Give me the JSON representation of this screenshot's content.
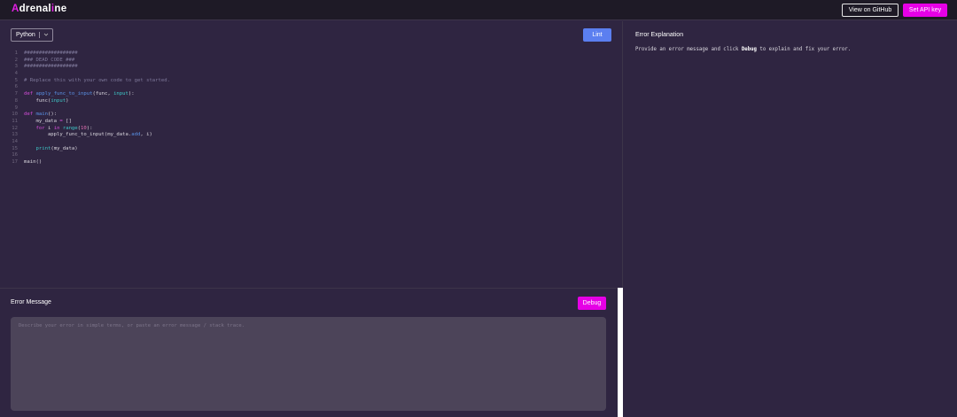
{
  "header": {
    "logo_prefix": "A",
    "logo_rest": "drenal",
    "logo_i": "i",
    "logo_suffix": "ne",
    "github_label": "View on GitHub",
    "api_key_label": "Set API key"
  },
  "editor": {
    "language": "Python",
    "lint_label": "Lint",
    "lines": [
      {
        "n": "1",
        "parts": [
          {
            "t": "##################",
            "c": "comment"
          }
        ]
      },
      {
        "n": "2",
        "parts": [
          {
            "t": "### DEAD CODE ###",
            "c": "comment"
          }
        ]
      },
      {
        "n": "3",
        "parts": [
          {
            "t": "##################",
            "c": "comment"
          }
        ]
      },
      {
        "n": "4",
        "parts": []
      },
      {
        "n": "5",
        "parts": [
          {
            "t": "# Replace this with your own code to get started.",
            "c": "comment"
          }
        ]
      },
      {
        "n": "6",
        "parts": []
      },
      {
        "n": "7",
        "parts": [
          {
            "t": "def",
            "c": "kw"
          },
          {
            "t": " ",
            "c": ""
          },
          {
            "t": "apply_func_to_input",
            "c": "fn"
          },
          {
            "t": "(func, ",
            "c": ""
          },
          {
            "t": "input",
            "c": "builtin"
          },
          {
            "t": "):",
            "c": ""
          }
        ]
      },
      {
        "n": "8",
        "parts": [
          {
            "t": "    func(",
            "c": ""
          },
          {
            "t": "input",
            "c": "builtin"
          },
          {
            "t": ")",
            "c": ""
          }
        ]
      },
      {
        "n": "9",
        "parts": []
      },
      {
        "n": "10",
        "parts": [
          {
            "t": "def",
            "c": "kw"
          },
          {
            "t": " ",
            "c": ""
          },
          {
            "t": "main",
            "c": "fn"
          },
          {
            "t": "():",
            "c": ""
          }
        ]
      },
      {
        "n": "11",
        "parts": [
          {
            "t": "    my_data ",
            "c": ""
          },
          {
            "t": "=",
            "c": "kw"
          },
          {
            "t": " []",
            "c": ""
          }
        ]
      },
      {
        "n": "12",
        "parts": [
          {
            "t": "    ",
            "c": ""
          },
          {
            "t": "for",
            "c": "kw"
          },
          {
            "t": " i ",
            "c": ""
          },
          {
            "t": "in",
            "c": "kw"
          },
          {
            "t": " ",
            "c": ""
          },
          {
            "t": "range",
            "c": "builtin"
          },
          {
            "t": "(",
            "c": ""
          },
          {
            "t": "10",
            "c": "num"
          },
          {
            "t": "):",
            "c": ""
          }
        ]
      },
      {
        "n": "13",
        "parts": [
          {
            "t": "        apply_func_to_input(my_data.",
            "c": ""
          },
          {
            "t": "add",
            "c": "fn"
          },
          {
            "t": ", i)",
            "c": ""
          }
        ]
      },
      {
        "n": "14",
        "parts": []
      },
      {
        "n": "15",
        "parts": [
          {
            "t": "    ",
            "c": ""
          },
          {
            "t": "print",
            "c": "builtin"
          },
          {
            "t": "(my_data)",
            "c": ""
          }
        ]
      },
      {
        "n": "16",
        "parts": []
      },
      {
        "n": "17",
        "parts": [
          {
            "t": "main()",
            "c": ""
          }
        ]
      }
    ]
  },
  "error_message": {
    "title": "Error Message",
    "debug_label": "Debug",
    "value": "",
    "placeholder": "Describe your error in simple terms, or paste an error message / stack trace."
  },
  "explanation": {
    "title": "Error Explanation",
    "text_before": "Provide an error message and click ",
    "text_strong": "Debug",
    "text_after": " to explain and fix your error."
  },
  "colors": {
    "accent": "#e600e6",
    "lint": "#5b7ff0",
    "background": "#2f2541",
    "topbar": "#1e1a26"
  },
  "icons": {
    "language_dropdown": "chevron-down-icon"
  }
}
